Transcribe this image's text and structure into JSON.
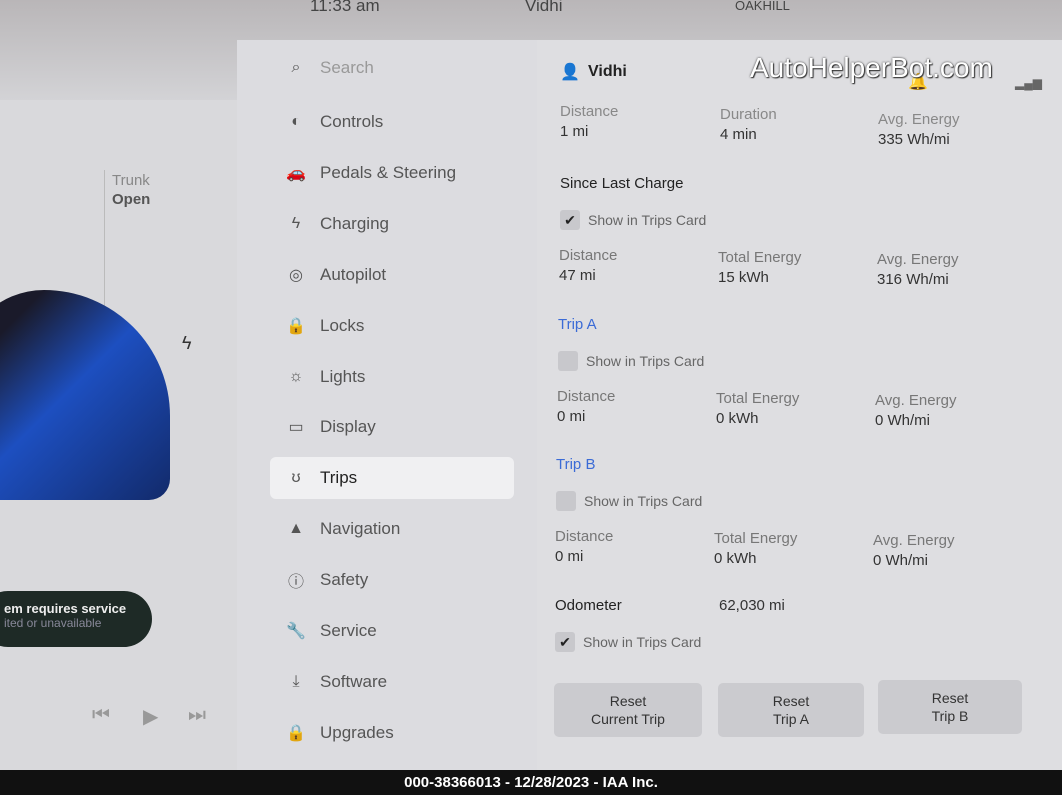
{
  "status_bar": {
    "time": "11:33 am",
    "user": "Vidhi",
    "location": "OAKHILL"
  },
  "watermark": "AutoHelperBot.com",
  "left_panel": {
    "trunk_label": "Trunk",
    "trunk_value": "Open",
    "alert_title": "em requires service",
    "alert_sub": "ited or unavailable"
  },
  "media": {
    "prev": "⏮",
    "play": "▶",
    "next": "⏭"
  },
  "menu": {
    "search": "Search",
    "items": [
      {
        "label": "Controls",
        "icon": "◐"
      },
      {
        "label": "Pedals & Steering",
        "icon": "🚗"
      },
      {
        "label": "Charging",
        "icon": "ϟ"
      },
      {
        "label": "Autopilot",
        "icon": "◎"
      },
      {
        "label": "Locks",
        "icon": "🔒"
      },
      {
        "label": "Lights",
        "icon": "☼"
      },
      {
        "label": "Display",
        "icon": "▭"
      },
      {
        "label": "Trips",
        "icon": "ʊ"
      },
      {
        "label": "Navigation",
        "icon": "▲"
      },
      {
        "label": "Safety",
        "icon": "ⓘ"
      },
      {
        "label": "Service",
        "icon": "🔧"
      },
      {
        "label": "Software",
        "icon": "⤓"
      },
      {
        "label": "Upgrades",
        "icon": "🔒"
      }
    ],
    "selected": "Trips"
  },
  "content": {
    "user": "Vidhi",
    "current": {
      "distance_label": "Distance",
      "distance": "1 mi",
      "duration_label": "Duration",
      "duration": "4 min",
      "energy_label": "Avg. Energy",
      "energy": "335 Wh/mi"
    },
    "since_last_charge": {
      "title": "Since Last Charge",
      "checkbox": "Show in Trips Card",
      "checked": true,
      "distance_label": "Distance",
      "distance": "47 mi",
      "total_label": "Total Energy",
      "total": "15 kWh",
      "avg_label": "Avg. Energy",
      "avg": "316 Wh/mi"
    },
    "trip_a": {
      "title": "Trip A",
      "checkbox": "Show in Trips Card",
      "checked": false,
      "distance_label": "Distance",
      "distance": "0 mi",
      "total_label": "Total Energy",
      "total": "0 kWh",
      "avg_label": "Avg. Energy",
      "avg": "0 Wh/mi"
    },
    "trip_b": {
      "title": "Trip B",
      "checkbox": "Show in Trips Card",
      "checked": false,
      "distance_label": "Distance",
      "distance": "0 mi",
      "total_label": "Total Energy",
      "total": "0 kWh",
      "avg_label": "Avg. Energy",
      "avg": "0 Wh/mi"
    },
    "odometer": {
      "label": "Odometer",
      "value": "62,030 mi",
      "checkbox": "Show in Trips Card",
      "checked": true
    },
    "buttons": {
      "reset_current": "Reset\nCurrent Trip",
      "reset_a": "Reset\nTrip A",
      "reset_b": "Reset\nTrip B"
    }
  },
  "footer": "000-38366013 - 12/28/2023 - IAA Inc."
}
